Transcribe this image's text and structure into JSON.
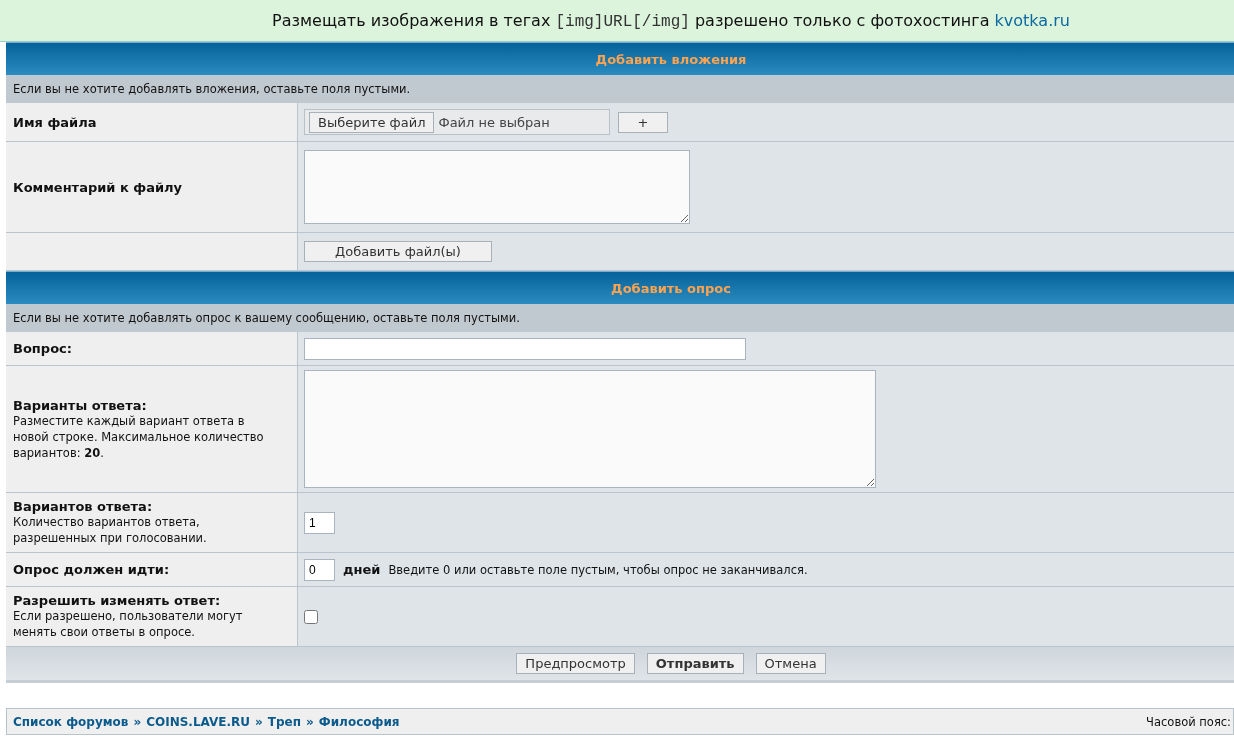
{
  "notice": [
    {
      "kind": "text",
      "text": "Размещать изображения в тегах "
    },
    {
      "kind": "code",
      "text": "[img]URL[/img]"
    },
    {
      "kind": "text",
      "text": " разрешено только с фотохостинга "
    },
    {
      "kind": "link",
      "text": "kvotka.ru"
    }
  ],
  "sections": [
    {
      "title": "Добавить вложения",
      "hint": "Если вы не хотите добавлять вложения, оставьте поля пустыми.",
      "rows": [
        {
          "kind": "file",
          "label": "Имя файла",
          "button": "Выберите файл",
          "status": "Файл не выбран",
          "add": "+"
        },
        {
          "kind": "comment",
          "label": "Комментарий к файлу"
        },
        {
          "kind": "button",
          "button": "Добавить файл(ы)"
        }
      ]
    },
    {
      "title": "Добавить опрос",
      "hint": "Если вы не хотите добавлять опрос к вашему сообщению, оставьте поля пустыми.",
      "rows": [
        {
          "kind": "text",
          "label": "Вопрос:"
        },
        {
          "kind": "options",
          "label": "Варианты ответа:",
          "description": "Разместите каждый вариант ответа в новой строке. Максимальное количество вариантов: **20**."
        },
        {
          "kind": "number",
          "label": "Вариантов ответа:",
          "description": "Количество вариантов ответа, разрешенных при голосовании.",
          "value": "1"
        },
        {
          "kind": "number",
          "label": "Опрос должен идти:",
          "value": "0",
          "unit": "дней",
          "note": "Введите 0 или оставьте поле пустым, чтобы опрос не заканчивался."
        },
        {
          "kind": "checkbox",
          "label": "Разрешить изменять ответ:",
          "description": "Если разрешено, пользователи могут менять свои ответы в опросе.",
          "checked": false
        }
      ]
    }
  ],
  "actions": [
    {
      "label": "Предпросмотр",
      "primary": false
    },
    {
      "label": "Отправить",
      "primary": true
    },
    {
      "label": "Отмена",
      "primary": false
    }
  ],
  "breadcrumbs": [
    {
      "label": "Список форумов",
      "separator": "»"
    },
    {
      "label": "COINS.LAVE.RU",
      "separator": "»"
    },
    {
      "label": "Треп",
      "separator": "»"
    },
    {
      "label": "Философия"
    }
  ],
  "timezone": "Часовой пояс:"
}
